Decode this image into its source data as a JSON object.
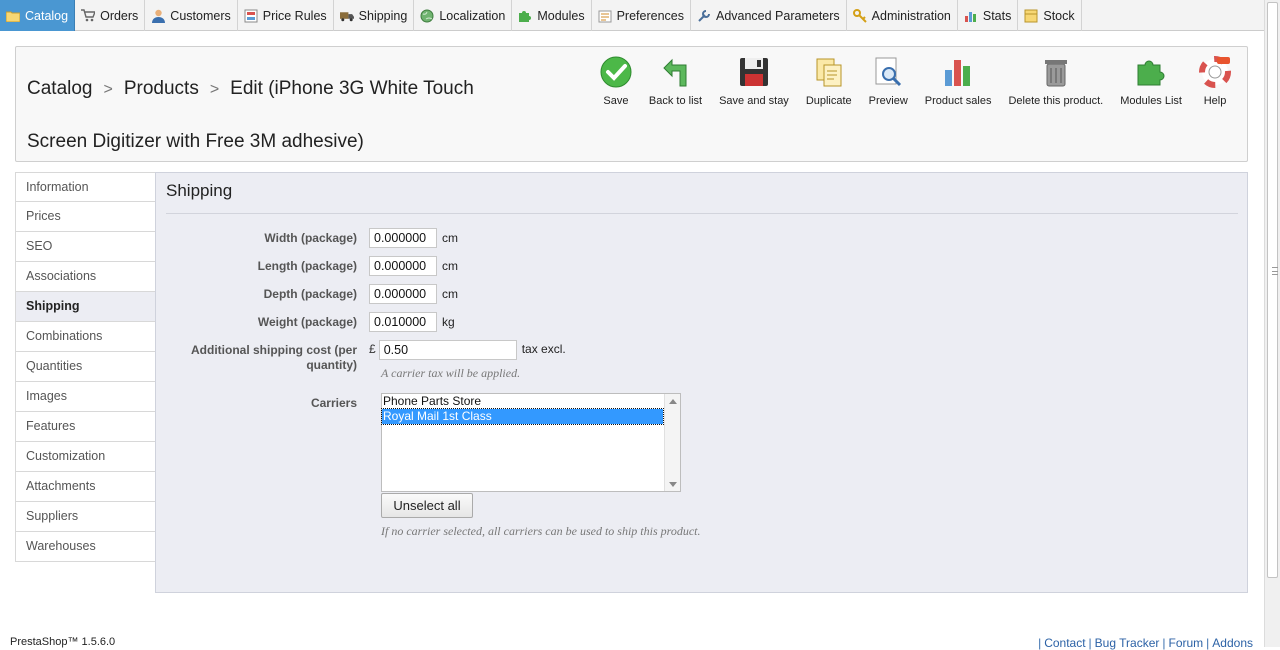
{
  "top_menu": [
    {
      "label": "Catalog",
      "icon": "folder-icon",
      "active": true
    },
    {
      "label": "Orders",
      "icon": "cart-icon"
    },
    {
      "label": "Customers",
      "icon": "user-icon"
    },
    {
      "label": "Price Rules",
      "icon": "price-tag-icon"
    },
    {
      "label": "Shipping",
      "icon": "truck-icon"
    },
    {
      "label": "Localization",
      "icon": "globe-icon"
    },
    {
      "label": "Modules",
      "icon": "puzzle-icon"
    },
    {
      "label": "Preferences",
      "icon": "preferences-icon"
    },
    {
      "label": "Advanced Parameters",
      "icon": "wrench-icon"
    },
    {
      "label": "Administration",
      "icon": "key-icon"
    },
    {
      "label": "Stats",
      "icon": "chart-icon"
    },
    {
      "label": "Stock",
      "icon": "stock-icon"
    }
  ],
  "breadcrumb": {
    "catalog": "Catalog",
    "products": "Products",
    "current": "Edit (iPhone 3G White Touch Screen Digitizer with Free 3M adhesive)"
  },
  "toolbar": {
    "save": "Save",
    "back": "Back to list",
    "save_stay": "Save and stay",
    "duplicate": "Duplicate",
    "preview": "Preview",
    "product_sales": "Product sales",
    "delete": "Delete this product.",
    "modules_list": "Modules List",
    "help": "Help"
  },
  "side_tabs": [
    {
      "label": "Information"
    },
    {
      "label": "Prices"
    },
    {
      "label": "SEO"
    },
    {
      "label": "Associations"
    },
    {
      "label": "Shipping",
      "active": true
    },
    {
      "label": "Combinations"
    },
    {
      "label": "Quantities"
    },
    {
      "label": "Images"
    },
    {
      "label": "Features"
    },
    {
      "label": "Customization"
    },
    {
      "label": "Attachments"
    },
    {
      "label": "Suppliers"
    },
    {
      "label": "Warehouses"
    }
  ],
  "shipping": {
    "title": "Shipping",
    "width": {
      "label": "Width (package)",
      "value": "0.000000",
      "unit": "cm"
    },
    "length": {
      "label": "Length (package)",
      "value": "0.000000",
      "unit": "cm"
    },
    "depth": {
      "label": "Depth (package)",
      "value": "0.000000",
      "unit": "cm"
    },
    "weight": {
      "label": "Weight (package)",
      "value": "0.010000",
      "unit": "kg"
    },
    "additional_cost": {
      "label_line1": "Additional shipping cost (per",
      "label_line2": "quantity)",
      "currency": "£",
      "value": "0.50",
      "suffix": "tax excl.",
      "hint": "A carrier tax will be applied."
    },
    "carriers": {
      "label": "Carriers",
      "options": [
        "Phone Parts Store",
        "Royal Mail 1st Class"
      ],
      "selected_index": 1,
      "unselect_button": "Unselect all",
      "hint": "If no carrier selected, all carriers can be used to ship this product."
    }
  },
  "footer": {
    "version": "PrestaShop™ 1.5.6.0",
    "links": [
      "Contact",
      "Bug Tracker",
      "Forum",
      "Addons"
    ]
  },
  "colors": {
    "active_tab": "#4a97d2",
    "content_bg": "#ecedf3",
    "selected_option": "#3399ff"
  }
}
